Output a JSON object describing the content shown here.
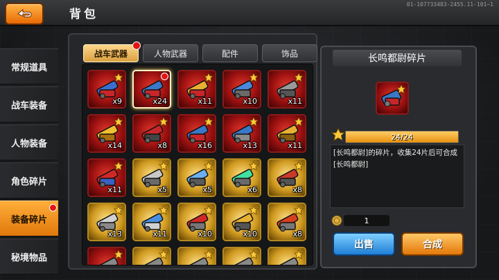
{
  "header": {
    "title": "背包",
    "server_id": "01-107733483-2455.11-101~1"
  },
  "sidebar": {
    "items": [
      {
        "label": "常规道具"
      },
      {
        "label": "战车装备"
      },
      {
        "label": "人物装备"
      },
      {
        "label": "角色碎片"
      },
      {
        "label": "装备碎片"
      },
      {
        "label": "秘境物品"
      }
    ],
    "active_index": 4
  },
  "tabs": [
    {
      "label": "战车武器"
    },
    {
      "label": "人物武器"
    },
    {
      "label": "配件"
    },
    {
      "label": "饰品"
    }
  ],
  "active_tab": 0,
  "items": [
    {
      "qty": "x9",
      "frame": "red",
      "art": "red-wings-icon"
    },
    {
      "qty": "x24",
      "frame": "red",
      "art": "cannon-icon",
      "selected": true,
      "dot": true
    },
    {
      "qty": "x11",
      "frame": "red",
      "art": "gold-cannon-icon"
    },
    {
      "qty": "x10",
      "frame": "red",
      "art": "blue-cannon-icon"
    },
    {
      "qty": "x11",
      "frame": "red",
      "art": "grey-gun-icon"
    },
    {
      "qty": "x14",
      "frame": "red",
      "art": "gold-drill-icon"
    },
    {
      "qty": "x8",
      "frame": "red",
      "art": "red-launcher-icon"
    },
    {
      "qty": "x16",
      "frame": "red",
      "art": "blue-tube-icon"
    },
    {
      "qty": "x13",
      "frame": "red",
      "art": "blue-rifle-icon"
    },
    {
      "qty": "x11",
      "frame": "red",
      "art": "gold-spike-icon"
    },
    {
      "qty": "x11",
      "frame": "red",
      "art": "red-spiked-icon"
    },
    {
      "qty": "x5",
      "frame": "gold",
      "art": "grey-cannon-icon"
    },
    {
      "qty": "x5",
      "frame": "gold",
      "art": "blue-laser-icon"
    },
    {
      "qty": "x6",
      "frame": "gold",
      "art": "green-orb-icon"
    },
    {
      "qty": "x8",
      "frame": "gold",
      "art": "red-box-icon"
    },
    {
      "qty": "x13",
      "frame": "gold",
      "art": "silver-block-icon"
    },
    {
      "qty": "x11",
      "frame": "gold",
      "art": "blue-gatling-icon"
    },
    {
      "qty": "x10",
      "frame": "gold",
      "art": "red-engine-icon"
    },
    {
      "qty": "x10",
      "frame": "gold",
      "art": "gold-rod-icon"
    },
    {
      "qty": "x8",
      "frame": "gold",
      "art": "red-rocket-icon"
    },
    {
      "qty": "",
      "frame": "red",
      "art": "partial-item-icon"
    },
    {
      "qty": "",
      "frame": "gold",
      "art": "partial-item-icon"
    },
    {
      "qty": "",
      "frame": "gold",
      "art": "partial-item-icon"
    },
    {
      "qty": "",
      "frame": "gold",
      "art": "partial-item-icon"
    },
    {
      "qty": "",
      "frame": "gold",
      "art": "partial-item-icon"
    }
  ],
  "detail": {
    "title": "长鸣都尉碎片",
    "progress_text": "24/24",
    "progress_fraction": 1.0,
    "description": "[长鸣都尉]的碎片，收集24片后可合成[长鸣都尉]",
    "price": "1",
    "sell_label": "出售",
    "craft_label": "合成"
  },
  "colors": {
    "accent_orange": "#e8920e",
    "red_frame": "#9a1010",
    "gold_frame": "#d09a20",
    "sell_blue": "#1e7ed6"
  }
}
